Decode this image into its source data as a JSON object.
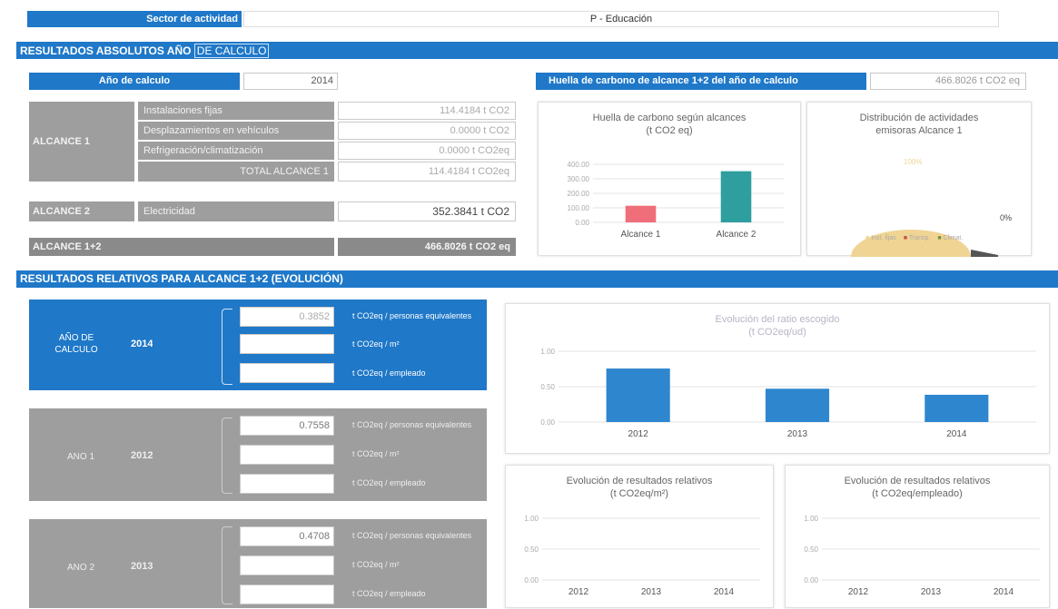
{
  "header": {
    "sector_label": "Sector de actividad",
    "sector_value": "P - Educación",
    "absolutos_title_a": "RESULTADOS ABSOLUTOS AÑO ",
    "absolutos_title_b": "DE CALCULO"
  },
  "anio_calculo": {
    "label": "Año de calculo",
    "value": "2014"
  },
  "huella_total": {
    "label": "Huella de carbono de alcance 1+2 del año de calculo",
    "value": "466.8026 t CO2 eq"
  },
  "alcance1": {
    "label": "ALCANCE 1",
    "rows": [
      {
        "label": "Instalaciones fijas",
        "value": "114.4184 t CO2"
      },
      {
        "label": "Desplazamientos en vehículos",
        "value": "0.0000 t CO2"
      },
      {
        "label": "Refrigeración/climatización",
        "value": "0.0000 t CO2eq"
      }
    ],
    "total_label": "TOTAL ALCANCE 1",
    "total_value": "114.4184 t CO2eq"
  },
  "alcance2": {
    "label": "ALCANCE 2",
    "sub": "Electricidad",
    "value": "352.3841 t CO2"
  },
  "alcance12": {
    "label": "ALCANCE 1+2",
    "value": "466.8026 t CO2 eq"
  },
  "chart_alcances": {
    "title": "Huella de carbono según alcances",
    "subtitle": "(t CO2 eq)",
    "yticks": [
      "400.00",
      "300.00",
      "200.00",
      "100.00",
      "0.00"
    ]
  },
  "chart_distribucion": {
    "title": "Distribución de actividades",
    "subtitle": "emisoras  Alcance 1",
    "pct_main": "100%",
    "pct_small": "0%",
    "legend": [
      "Inst. fijas",
      "Transp.",
      "Climat."
    ],
    "colors": [
      "#f0d493",
      "#c0504d",
      "#77933c"
    ]
  },
  "relativos": {
    "title": "RESULTADOS RELATIVOS PARA ALCANCE 1+2 (EVOLUCIÓN)",
    "units": [
      "t CO2eq / personas equivalentes",
      "t CO2eq / m²",
      "t CO2eq / empleado"
    ],
    "blocks": [
      {
        "label": "AÑO DE CALCULO",
        "year": "2014",
        "values": [
          "0.3852",
          "",
          ""
        ]
      },
      {
        "label": "AÑO 1",
        "year": "2012",
        "values": [
          "0.7558",
          "",
          ""
        ]
      },
      {
        "label": "AÑO 2",
        "year": "2013",
        "values": [
          "0.4708",
          "",
          ""
        ]
      }
    ]
  },
  "chart_evol_ratio": {
    "title": "Evolución del ratio escogido",
    "subtitle": "(t CO2eq/ud)",
    "yticks": [
      "1.00",
      "0.50",
      "0.00"
    ]
  },
  "chart_evol_m2": {
    "title": "Evolución de resultados relativos",
    "subtitle": "(t CO2eq/m²)",
    "yticks": [
      "1.00",
      "0.50",
      "0.00"
    ]
  },
  "chart_evol_emp": {
    "title": "Evolución de resultados relativos",
    "subtitle": "(t CO2eq/empleado)",
    "yticks": [
      "1.00",
      "0.50",
      "0.00"
    ]
  },
  "chart_data": [
    {
      "type": "bar",
      "title": "Huella de carbono según alcances",
      "ylabel": "t CO2 eq",
      "categories": [
        "Alcance 1",
        "Alcance 2"
      ],
      "values": [
        114.42,
        352.38
      ],
      "colors": [
        "#f06e7a",
        "#2f9e9e"
      ],
      "ylim": [
        0,
        400
      ],
      "grid": true
    },
    {
      "type": "pie",
      "title": "Distribución de actividades emisoras Alcance 1",
      "categories": [
        "Inst. fijas",
        "Transp.",
        "Climat."
      ],
      "values": [
        100,
        0,
        0
      ]
    },
    {
      "type": "bar",
      "title": "Evolución del ratio escogido",
      "ylabel": "t CO2eq/ud",
      "categories": [
        "2012",
        "2013",
        "2014"
      ],
      "values": [
        0.7558,
        0.4708,
        0.3852
      ],
      "ylim": [
        0,
        1
      ],
      "grid": true
    },
    {
      "type": "bar",
      "title": "Evolución de resultados relativos",
      "ylabel": "t CO2eq/m²",
      "categories": [
        "2012",
        "2013",
        "2014"
      ],
      "values": [
        0,
        0,
        0
      ],
      "ylim": [
        0,
        1
      ],
      "grid": true
    },
    {
      "type": "bar",
      "title": "Evolución de resultados relativos",
      "ylabel": "t CO2eq/empleado",
      "categories": [
        "2012",
        "2013",
        "2014"
      ],
      "values": [
        0,
        0,
        0
      ],
      "ylim": [
        0,
        1
      ],
      "grid": true
    }
  ]
}
